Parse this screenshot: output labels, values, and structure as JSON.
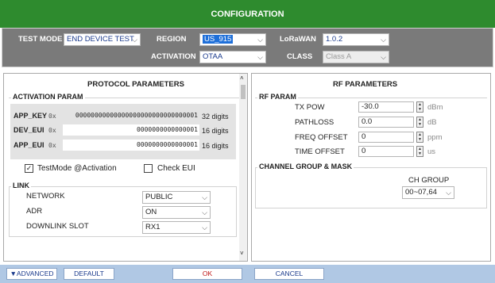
{
  "title": "CONFIGURATION",
  "header": {
    "test_mode_label": "TEST MODE",
    "test_mode_value": "END DEVICE TEST",
    "region_label": "REGION",
    "region_value": "US_915",
    "lorawan_label": "LoRaWAN",
    "lorawan_value": "1.0.2",
    "activation_label": "ACTIVATION",
    "activation_value": "OTAA",
    "class_label": "CLASS",
    "class_value": "Class A"
  },
  "protocol": {
    "title": "PROTOCOL PARAMETERS",
    "activation_group": "ACTIVATION PARAM",
    "keys": [
      {
        "label": "APP_KEY",
        "prefix": "0x",
        "value": "00000000000000000000000000000001",
        "digits": "32 digits"
      },
      {
        "label": "DEV_EUI",
        "prefix": "0x",
        "value": "0000000000000001",
        "digits": "16 digits"
      },
      {
        "label": "APP_EUI",
        "prefix": "0x",
        "value": "0000000000000001",
        "digits": "16 digits"
      }
    ],
    "testmode_activation_label": "TestMode @Activation",
    "testmode_activation_checked": true,
    "check_eui_label": "Check EUI",
    "check_eui_checked": false,
    "link_group": "LINK",
    "link": [
      {
        "label": "NETWORK",
        "value": "PUBLIC"
      },
      {
        "label": "ADR",
        "value": "ON"
      },
      {
        "label": "DOWNLINK SLOT",
        "value": "RX1"
      }
    ]
  },
  "rf": {
    "title": "RF PARAMETERS",
    "rf_group": "RF PARAM",
    "params": [
      {
        "label": "TX POW",
        "value": "-30.0",
        "unit": "dBm"
      },
      {
        "label": "PATHLOSS",
        "value": "0.0",
        "unit": "dB"
      },
      {
        "label": "FREQ OFFSET",
        "value": "0",
        "unit": "ppm"
      },
      {
        "label": "TIME OFFSET",
        "value": "0",
        "unit": "us"
      }
    ],
    "channel_group": "CHANNEL GROUP & MASK",
    "ch_group_label": "CH GROUP",
    "ch_group_value": "00~07,64"
  },
  "footer": {
    "advanced": "▼ADVANCED",
    "default": "DEFAULT",
    "ok": "OK",
    "cancel": "CANCEL"
  },
  "colors": {
    "title_bar": "#2e8b2e",
    "header_bar": "#7a7a7a",
    "footer_bar": "#b0c8e4",
    "selection": "#1e6fd9"
  }
}
